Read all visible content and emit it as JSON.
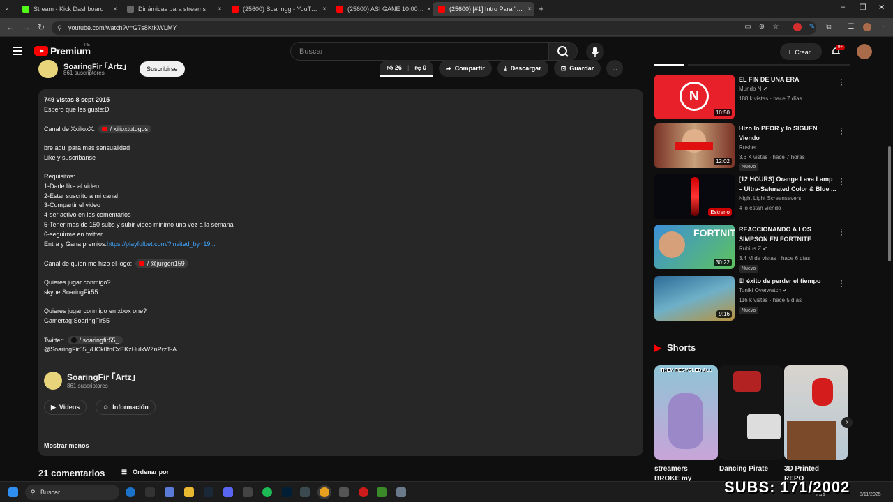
{
  "browser": {
    "tabs": [
      {
        "title": "Stream - Kick Dashboard",
        "color": "#53fc18"
      },
      {
        "title": "Dinámicas para streams",
        "color": "#888888"
      },
      {
        "title": "(25600) Soaringg - YouTube",
        "color": "#ff0000"
      },
      {
        "title": "(25600) ASÍ GANÉ 10,000$ CON...",
        "color": "#ff0000"
      },
      {
        "title": "(25600) [#1] Intro Para \"XxilioxX...",
        "color": "#ff0000"
      }
    ],
    "new_tab": "+",
    "url": "youtube.com/watch?v=G7s8KtKWLMY"
  },
  "header": {
    "brand": "Premium",
    "region": "PE",
    "search_placeholder": "Buscar",
    "create_label": "Crear",
    "notif_count": "9+"
  },
  "channel": {
    "name": "SoaringFir ｢Artz｣",
    "subs": "861 suscriptores",
    "subscribe_label": "Suscribirse"
  },
  "actions": {
    "likes": "26",
    "dislikes": "0",
    "share": "Compartir",
    "download": "Descargar",
    "save": "Guardar",
    "more": "..."
  },
  "description": {
    "meta": "749 vistas  8 sept 2015",
    "line1": "Espero que les guste:D",
    "channel_x_label": "Canal de XxilioxX:",
    "channel_x_link": "/ xilioxtutogos",
    "line3": "bre aqui para mas sensualidad",
    "line4": "Like y suscribanse",
    "req_title": "Requisitos:",
    "req1": "1-Darle like al video",
    "req2": "2-Estar suscrito a mi canal",
    "req3": "3-Compartir el video",
    "req4": "4-ser activo en los comentarios",
    "req5": "5-Tener mas de 150 subs y subir video minimo una vez a la semana",
    "req6": "6-seguirme en twitter",
    "prizes_label": "Entra y Gana premios:",
    "prizes_link": "https://playfulbet.com/?invited_by=19...",
    "logo_label": "Canal de quien me hizo el logo:",
    "logo_link": "/ @jurgen159",
    "q1": "Quieres jugar conmigo?",
    "skype": "skype:SoaringFir55",
    "q2": "Quieres jugar conmigo en xbox one?",
    "gamertag": "Gamertag:SoaringFir55",
    "twitter_label": "Twitter:",
    "twitter_link": "/ soaringfir55_",
    "handle": "@SoaringFir55_/UCk0fnCxEKzHulkWZnPrzT-A",
    "card_name": "SoaringFir ｢Artz｣",
    "card_subs": "861 suscriptores",
    "videos_label": "Videos",
    "info_label": "Información",
    "show_less": "Mostrar menos"
  },
  "comments": {
    "count": "21 comentarios",
    "sort": "Ordenar por"
  },
  "sidebar": {
    "videos": [
      {
        "title": "EL FIN DE UNA ERA",
        "channel": "Mundo N",
        "meta": "188 k vistas · hace 7 días",
        "duration": "10:50",
        "nuevo": "",
        "thumb": "#e8202a"
      },
      {
        "title": "Hizo lo PEOR y lo SIGUEN Viendo",
        "channel": "Rusher",
        "meta": "3.6 K vistas · hace 7 horas",
        "duration": "12:02",
        "nuevo": "Nuevo",
        "thumb": "#8a3c2e"
      },
      {
        "title": "[12 HOURS] Orange Lava Lamp – Ultra-Saturated Color & Blue ...",
        "channel": "Night Light Screensavers",
        "meta": "4 lo están viendo",
        "duration": "Estreno",
        "nuevo": "",
        "thumb": "#0a0a14"
      },
      {
        "title": "REACCIONANDO A LOS SIMPSON EN FORTNITE",
        "channel": "Rubius Z",
        "meta": "3.4 M de vistas · hace 6 días",
        "duration": "30:22",
        "nuevo": "Nuevo",
        "thumb": "#3d8fd8"
      },
      {
        "title": "El éxito de perder el tiempo",
        "channel": "Toniki Overwatch",
        "meta": "116 k vistas · hace 5 días",
        "duration": "9:16",
        "nuevo": "Nuevo",
        "thumb": "#4a8aa8"
      }
    ],
    "shorts_heading": "Shorts",
    "shorts": [
      {
        "title": "streamers BROKE my",
        "tag": "THEY RECYCLED ALL",
        "color": "#7fb3c8"
      },
      {
        "title": "Dancing Pirate",
        "tag": "",
        "color": "#1a1a1a"
      },
      {
        "title": "3D Printed REPO",
        "tag": "",
        "color": "#d8d2cc"
      }
    ]
  },
  "taskbar": {
    "search_label": "Buscar",
    "overlay": "SUBS: 171/2002",
    "lang": "LAA",
    "date": "8/11/2025"
  }
}
